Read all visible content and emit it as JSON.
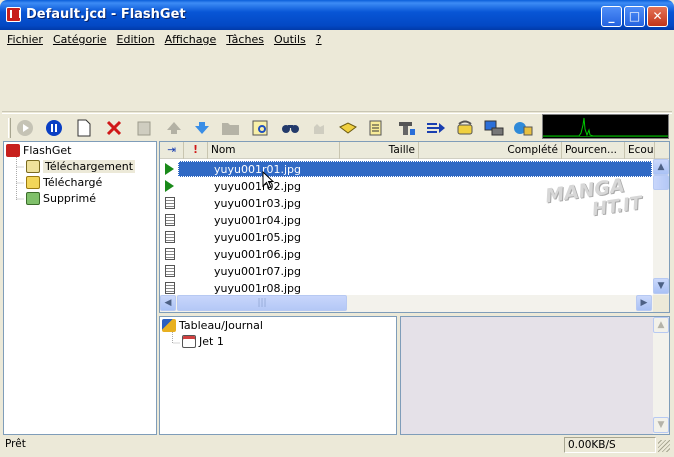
{
  "window": {
    "title": "Default.jcd - FlashGet"
  },
  "menu": [
    "Fichier",
    "Catégorie",
    "Edition",
    "Affichage",
    "Tâches",
    "Outils",
    "?"
  ],
  "toolbar": {
    "icons": [
      "start-icon",
      "pause-icon",
      "new-icon",
      "delete-icon",
      "properties-icon",
      "move-up-icon",
      "move-down-icon",
      "open-folder-icon",
      "open-file-icon",
      "find-icon",
      "hand-icon",
      "options-icon",
      "log-icon",
      "site-icon",
      "batch-icon",
      "dial-icon",
      "network-icon",
      "globe-icon"
    ]
  },
  "tree": {
    "root": "FlashGet",
    "items": [
      "Téléchargement",
      "Téléchargé",
      "Supprimé"
    ],
    "selected_index": 0
  },
  "list": {
    "columns": [
      "Nom",
      "Taille",
      "Complété",
      "Pourcen...",
      "Ecou"
    ],
    "rows": [
      {
        "name": "yuyu001r01.jpg",
        "status": "running"
      },
      {
        "name": "yuyu001r02.jpg",
        "status": "running"
      },
      {
        "name": "yuyu001r03.jpg",
        "status": "queued"
      },
      {
        "name": "yuyu001r04.jpg",
        "status": "queued"
      },
      {
        "name": "yuyu001r05.jpg",
        "status": "queued"
      },
      {
        "name": "yuyu001r06.jpg",
        "status": "queued"
      },
      {
        "name": "yuyu001r07.jpg",
        "status": "queued"
      },
      {
        "name": "yuyu001r08.jpg",
        "status": "queued"
      }
    ],
    "selected_index": 0
  },
  "log": {
    "root": "Tableau/Journal",
    "items": [
      "Jet 1"
    ]
  },
  "watermark": {
    "line1": "MANGA",
    "line2": "HT.IT"
  },
  "status": {
    "left": "Prêt",
    "speed": "0.00KB/S"
  },
  "colors": {
    "selection": "#316ac5",
    "title_blue": "#0348c4",
    "graph_green": "#00c800"
  }
}
